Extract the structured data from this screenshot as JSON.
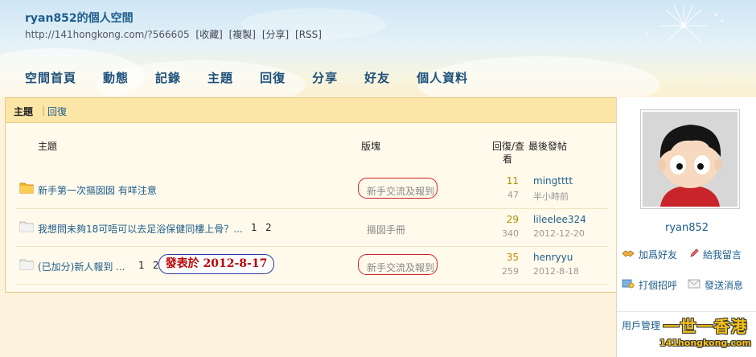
{
  "header": {
    "title": "ryan852的個人空間",
    "url": "http://141hongkong.com/?566605",
    "url_links": [
      "[收藏]",
      "[複製]",
      "[分享]",
      "[RSS]"
    ]
  },
  "nav": {
    "items": [
      "空間首頁",
      "動態",
      "記錄",
      "主題",
      "回復",
      "分享",
      "好友",
      "個人資料"
    ]
  },
  "tabs": {
    "active": "主題",
    "other": "回復"
  },
  "table": {
    "headers": {
      "subject": "主題",
      "forum": "版塊",
      "replies_views_1": "回復/查",
      "replies_views_2": "看",
      "last_post": "最後發帖"
    },
    "rows": [
      {
        "title": "新手第一次摳囡囡 有咩注意",
        "pages": [],
        "forum": "新手交流及報到",
        "replies": "11",
        "views": "47",
        "last_user": "mingtttt",
        "last_time": "半小時前",
        "icon": "folder-hot-icon"
      },
      {
        "title": "我想問未夠18可唔可以去足浴保健同樓上骨？...",
        "pages": [
          "1",
          "2"
        ],
        "forum": "摳囡手冊",
        "replies": "29",
        "views": "340",
        "last_user": "lileelee324",
        "last_time": "2012-12-20",
        "icon": "folder-icon"
      },
      {
        "title": "(已加分)新人報到 ...",
        "pages": [
          "1",
          "2"
        ],
        "forum": "新手交流及報到",
        "replies": "35",
        "views": "259",
        "last_user": "henryyu",
        "last_time": "2012-8-18",
        "icon": "folder-icon"
      }
    ]
  },
  "annotation": "發表於 2012-8-17",
  "sidebar": {
    "username": "ryan852",
    "add_friend": "加爲好友",
    "leave_message": "給我留言",
    "greet": "打個招呼",
    "send_message": "發送消息",
    "user_management": "用戶管理"
  },
  "watermark": {
    "main": "一世一香港",
    "sub": "141hongkong.com"
  },
  "colors": {
    "link": "#1f5d8c",
    "tabbar": "#fbe6a8",
    "accent_red": "#cc2222",
    "annotation_border": "#2a3aa0"
  }
}
